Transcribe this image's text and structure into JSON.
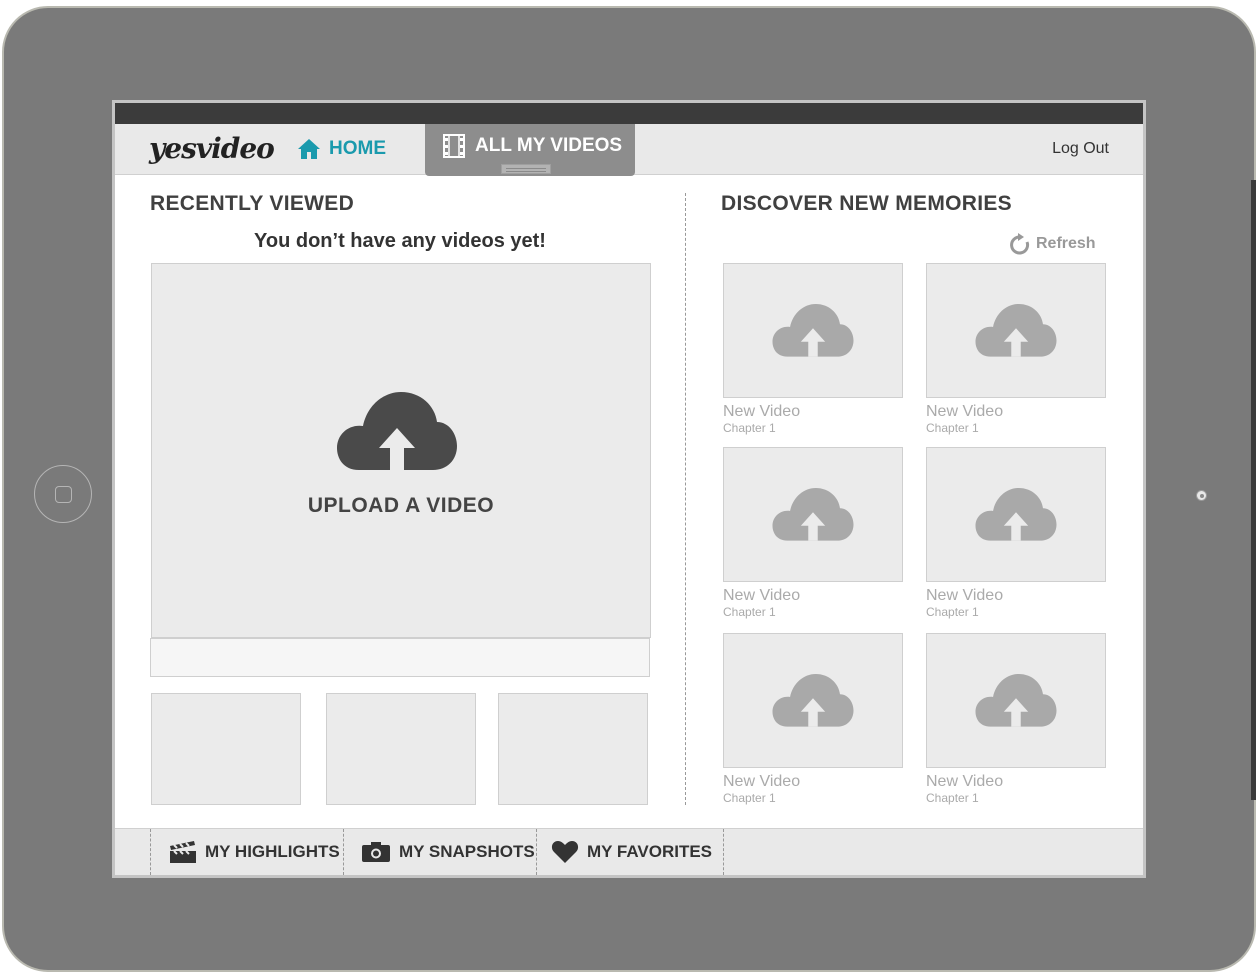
{
  "app": {
    "logo": "yesvideo",
    "nav": {
      "home": "HOME",
      "all_videos": "ALL MY VIDEOS",
      "logout": "Log Out"
    }
  },
  "recent": {
    "title": "RECENTLY VIEWED",
    "empty_message": "You don’t have any videos yet!",
    "upload_label": "UPLOAD A VIDEO",
    "upload_icon": "cloud-upload-icon"
  },
  "discover": {
    "title": "DISCOVER NEW MEMORIES",
    "refresh": "Refresh",
    "tiles": [
      {
        "title": "New Video",
        "subtitle": "Chapter 1"
      },
      {
        "title": "New Video",
        "subtitle": "Chapter 1"
      },
      {
        "title": "New Video",
        "subtitle": "Chapter 1"
      },
      {
        "title": "New Video",
        "subtitle": "Chapter 1"
      },
      {
        "title": "New Video",
        "subtitle": "Chapter 1"
      },
      {
        "title": "New Video",
        "subtitle": "Chapter 1"
      }
    ]
  },
  "bottom_nav": {
    "highlights": "MY HIGHLIGHTS",
    "snapshots": "MY SNAPSHOTS",
    "favorites": "MY FAVORITES"
  },
  "colors": {
    "accent": "#1a9aad",
    "frame": "#7a7a7a",
    "placeholder": "#ebebeb"
  }
}
